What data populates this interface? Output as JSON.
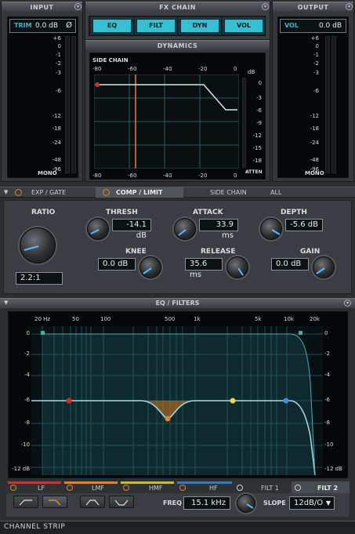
{
  "input": {
    "title": "INPUT",
    "trim_label": "TRIM",
    "trim_value": "0.0 dB",
    "phase_symbol": "Ø",
    "scale": [
      "+6",
      "0",
      "-1",
      "-2",
      "-3",
      "-6",
      "-12",
      "-18",
      "-24",
      "-48",
      "-96"
    ],
    "mono": "MONO"
  },
  "fxchain": {
    "title": "FX CHAIN",
    "buttons": [
      "EQ",
      "FILT",
      "DYN",
      "VOL"
    ]
  },
  "output": {
    "title": "OUTPUT",
    "vol_label": "VOL",
    "vol_value": "0.0 dB",
    "scale": [
      "+6",
      "0",
      "-1",
      "-2",
      "-3",
      "-6",
      "-12",
      "-18",
      "-24",
      "-48",
      "-96"
    ],
    "mono": "MONO"
  },
  "dynamics": {
    "title": "DYNAMICS",
    "side_chain": "SIDE CHAIN",
    "db_unit": "dB",
    "atten": "ATTEN",
    "top_axis": [
      "-80",
      "-60",
      "-40",
      "-20",
      "0"
    ],
    "bottom_axis": [
      "-80",
      "-60",
      "-40",
      "-20",
      "0"
    ],
    "right_axis": [
      "0",
      "-3",
      "-6",
      "-9",
      "-12",
      "-15",
      "-18"
    ]
  },
  "tabs": {
    "exp_gate": "EXP / GATE",
    "comp_limit": "COMP / LIMIT",
    "side_chain": "SIDE CHAIN",
    "all": "ALL"
  },
  "comp": {
    "ratio_label": "RATIO",
    "ratio_value": "2.2:1",
    "thresh_label": "THRESH",
    "thresh_value": "-14.1 dB",
    "attack_label": "ATTACK",
    "attack_value": "33.9 ms",
    "depth_label": "DEPTH",
    "depth_value": "-5.6 dB",
    "knee_label": "KNEE",
    "knee_value": "0.0 dB",
    "release_label": "RELEASE",
    "release_value": "35.6 ms",
    "gain_label": "GAIN",
    "gain_value": "0.0 dB"
  },
  "eq": {
    "title": "EQ / FILTERS",
    "freq_axis": [
      "20 Hz",
      "50",
      "100",
      "500",
      "1k",
      "5k",
      "10k",
      "20k"
    ],
    "left_axis": [
      "0",
      "-2",
      "-4",
      "-6",
      "-8",
      "-10",
      "-12 dB"
    ],
    "right_axis": [
      "0",
      "-2",
      "-4",
      "-6",
      "-8",
      "-10",
      "-12 dB"
    ],
    "bands": [
      "LF",
      "LMF",
      "HMF",
      "HF",
      "FILT 1",
      "FILT 2"
    ],
    "freq_label": "FREQ",
    "freq_value": "15.1 kHz",
    "slope_label": "SLOPE",
    "slope_value": "12dB/O"
  },
  "footer": {
    "title": "CHANNEL STRIP"
  },
  "colors": {
    "accent": "#34c0d0",
    "orange": "#e0832c",
    "screen": "#050708"
  }
}
